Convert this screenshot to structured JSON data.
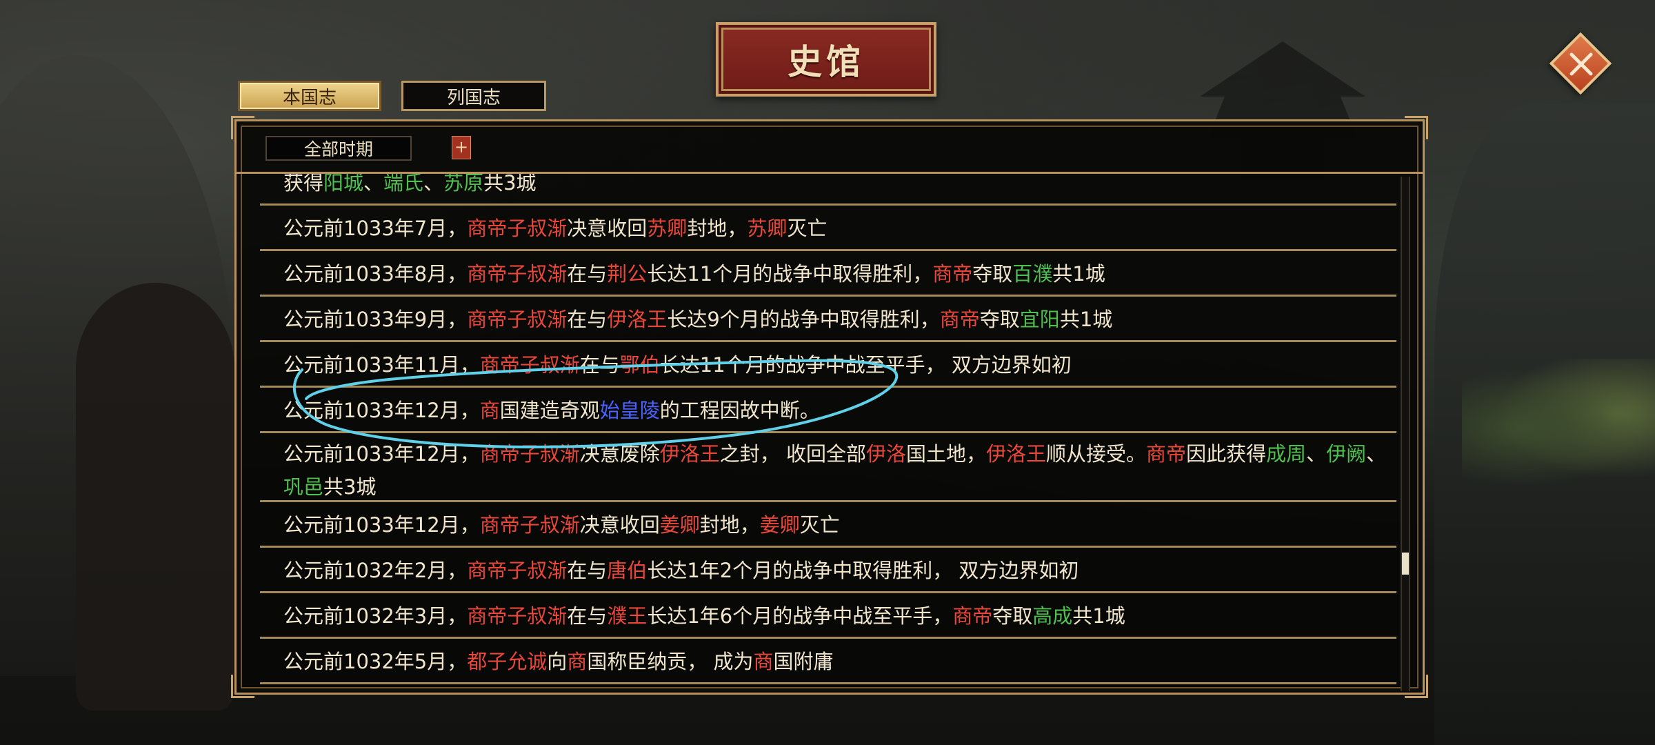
{
  "window": {
    "title": "史馆"
  },
  "close": {
    "icon": "close-x-icon"
  },
  "tabs": [
    {
      "label": "本国志",
      "active": true
    },
    {
      "label": "列国志",
      "active": false
    }
  ],
  "filter": {
    "period_label": "全部时期",
    "expand_label": "+"
  },
  "colors": {
    "text": "#f1e6cc",
    "person_state": "#e8473a",
    "city": "#4fc04f",
    "wonder": "#4a63ff",
    "annotation": "#5fd0e8"
  },
  "records": [
    {
      "segments": [
        {
          "t": "获得",
          "c": ""
        },
        {
          "t": "阳城",
          "c": "green"
        },
        {
          "t": "、",
          "c": ""
        },
        {
          "t": "端氏",
          "c": "green"
        },
        {
          "t": "、",
          "c": ""
        },
        {
          "t": "苏原",
          "c": "green"
        },
        {
          "t": "共3城",
          "c": ""
        }
      ]
    },
    {
      "segments": [
        {
          "t": "公元前1033年7月，",
          "c": ""
        },
        {
          "t": "商帝子叔渐",
          "c": "red"
        },
        {
          "t": "决意收回",
          "c": ""
        },
        {
          "t": "苏卿",
          "c": "red"
        },
        {
          "t": "封地，",
          "c": ""
        },
        {
          "t": "苏卿",
          "c": "red"
        },
        {
          "t": "灭亡",
          "c": ""
        }
      ]
    },
    {
      "segments": [
        {
          "t": "公元前1033年8月，",
          "c": ""
        },
        {
          "t": "商帝子叔渐",
          "c": "red"
        },
        {
          "t": "在与",
          "c": ""
        },
        {
          "t": "荆公",
          "c": "red"
        },
        {
          "t": "长达11个月的战争中取得胜利，",
          "c": ""
        },
        {
          "t": "商帝",
          "c": "red"
        },
        {
          "t": "夺取",
          "c": ""
        },
        {
          "t": "百濮",
          "c": "green"
        },
        {
          "t": "共1城",
          "c": ""
        }
      ]
    },
    {
      "segments": [
        {
          "t": "公元前1033年9月，",
          "c": ""
        },
        {
          "t": "商帝子叔渐",
          "c": "red"
        },
        {
          "t": "在与",
          "c": ""
        },
        {
          "t": "伊洛王",
          "c": "red"
        },
        {
          "t": "长达9个月的战争中取得胜利，",
          "c": ""
        },
        {
          "t": "商帝",
          "c": "red"
        },
        {
          "t": "夺取",
          "c": ""
        },
        {
          "t": "宜阳",
          "c": "green"
        },
        {
          "t": "共1城",
          "c": ""
        }
      ]
    },
    {
      "segments": [
        {
          "t": "公元前1033年11月，",
          "c": ""
        },
        {
          "t": "商帝子叔渐",
          "c": "red"
        },
        {
          "t": "在与",
          "c": ""
        },
        {
          "t": "鄂伯",
          "c": "red"
        },
        {
          "t": "长达11个月的战争中战至平手， 双方边界如初",
          "c": ""
        }
      ]
    },
    {
      "segments": [
        {
          "t": "公元前1033年12月，",
          "c": ""
        },
        {
          "t": "商",
          "c": "red"
        },
        {
          "t": "国建造奇观",
          "c": ""
        },
        {
          "t": "始皇陵",
          "c": "blue"
        },
        {
          "t": "的工程因故中断。",
          "c": ""
        }
      ]
    },
    {
      "two_line": true,
      "segments": [
        {
          "t": "公元前1033年12月，",
          "c": ""
        },
        {
          "t": "商帝子叔渐",
          "c": "red"
        },
        {
          "t": "决意废除",
          "c": ""
        },
        {
          "t": "伊洛王",
          "c": "red"
        },
        {
          "t": "之封， 收回全部",
          "c": ""
        },
        {
          "t": "伊洛",
          "c": "red"
        },
        {
          "t": "国土地，",
          "c": ""
        },
        {
          "t": "伊洛王",
          "c": "red"
        },
        {
          "t": "顺从接受。",
          "c": ""
        },
        {
          "t": "商帝",
          "c": "red"
        },
        {
          "t": "因此获得",
          "c": ""
        },
        {
          "t": "成周",
          "c": "green"
        },
        {
          "t": "、",
          "c": ""
        },
        {
          "t": "伊阙",
          "c": "green"
        },
        {
          "t": "、",
          "c": ""
        },
        {
          "t": "巩邑",
          "c": "green"
        },
        {
          "t": "共3城",
          "c": ""
        }
      ]
    },
    {
      "segments": [
        {
          "t": "公元前1033年12月，",
          "c": ""
        },
        {
          "t": "商帝子叔渐",
          "c": "red"
        },
        {
          "t": "决意收回",
          "c": ""
        },
        {
          "t": "姜卿",
          "c": "red"
        },
        {
          "t": "封地，",
          "c": ""
        },
        {
          "t": "姜卿",
          "c": "red"
        },
        {
          "t": "灭亡",
          "c": ""
        }
      ]
    },
    {
      "segments": [
        {
          "t": "公元前1032年2月，",
          "c": ""
        },
        {
          "t": "商帝子叔渐",
          "c": "red"
        },
        {
          "t": "在与",
          "c": ""
        },
        {
          "t": "唐伯",
          "c": "red"
        },
        {
          "t": "长达1年2个月的战争中取得胜利， 双方边界如初",
          "c": ""
        }
      ]
    },
    {
      "segments": [
        {
          "t": "公元前1032年3月，",
          "c": ""
        },
        {
          "t": "商帝子叔渐",
          "c": "red"
        },
        {
          "t": "在与",
          "c": ""
        },
        {
          "t": "濮王",
          "c": "red"
        },
        {
          "t": "长达1年6个月的战争中战至平手，",
          "c": ""
        },
        {
          "t": "商帝",
          "c": "red"
        },
        {
          "t": "夺取",
          "c": ""
        },
        {
          "t": "高成",
          "c": "green"
        },
        {
          "t": "共1城",
          "c": ""
        }
      ]
    },
    {
      "segments": [
        {
          "t": "公元前1032年5月，",
          "c": ""
        },
        {
          "t": "都子允诚",
          "c": "red"
        },
        {
          "t": "向",
          "c": ""
        },
        {
          "t": "商",
          "c": "red"
        },
        {
          "t": "国称臣纳贡， 成为",
          "c": ""
        },
        {
          "t": "商",
          "c": "red"
        },
        {
          "t": "国附庸",
          "c": ""
        }
      ]
    }
  ]
}
